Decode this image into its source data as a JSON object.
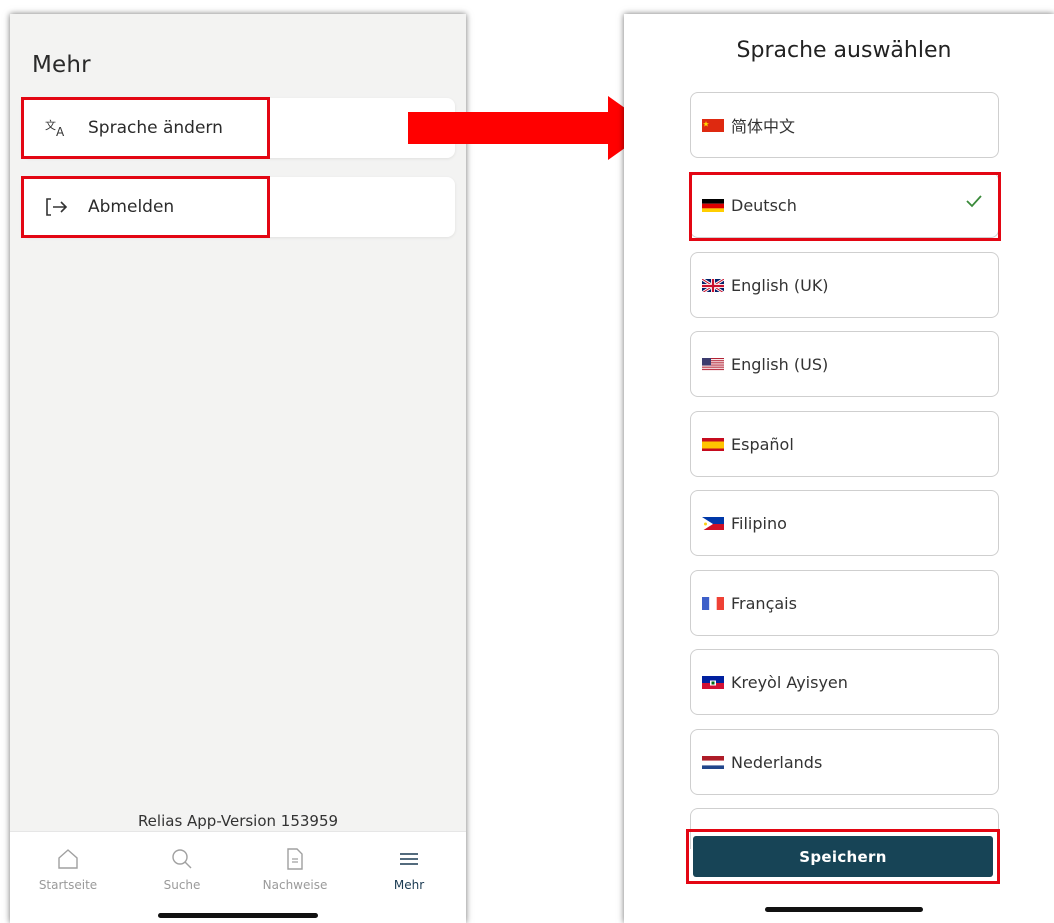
{
  "left_screen": {
    "title": "Mehr",
    "menu": [
      {
        "label": "Sprache ändern",
        "icon": "translate-icon"
      },
      {
        "label": "Abmelden",
        "icon": "logout-icon"
      }
    ],
    "version_text": "Relias App-Version 153959",
    "tabs": [
      {
        "label": "Startseite",
        "icon": "home-icon"
      },
      {
        "label": "Suche",
        "icon": "search-icon"
      },
      {
        "label": "Nachweise",
        "icon": "document-icon"
      },
      {
        "label": "Mehr",
        "icon": "menu-icon",
        "active": true
      }
    ]
  },
  "right_screen": {
    "title": "Sprache auswählen",
    "languages": [
      {
        "label": "简体中文",
        "flag": "china-flag"
      },
      {
        "label": "Deutsch",
        "flag": "germany-flag",
        "selected": true
      },
      {
        "label": "English (UK)",
        "flag": "uk-flag"
      },
      {
        "label": "English (US)",
        "flag": "us-flag"
      },
      {
        "label": "Español",
        "flag": "spain-flag"
      },
      {
        "label": "Filipino",
        "flag": "philippines-flag"
      },
      {
        "label": "Français",
        "flag": "france-flag"
      },
      {
        "label": "Kreyòl Ayisyen",
        "flag": "haiti-flag"
      },
      {
        "label": "Nederlands",
        "flag": "netherlands-flag"
      }
    ],
    "save_label": "Speichern"
  },
  "colors": {
    "highlight": "#e30613",
    "primary": "#174456",
    "check": "#3a8a3a"
  }
}
